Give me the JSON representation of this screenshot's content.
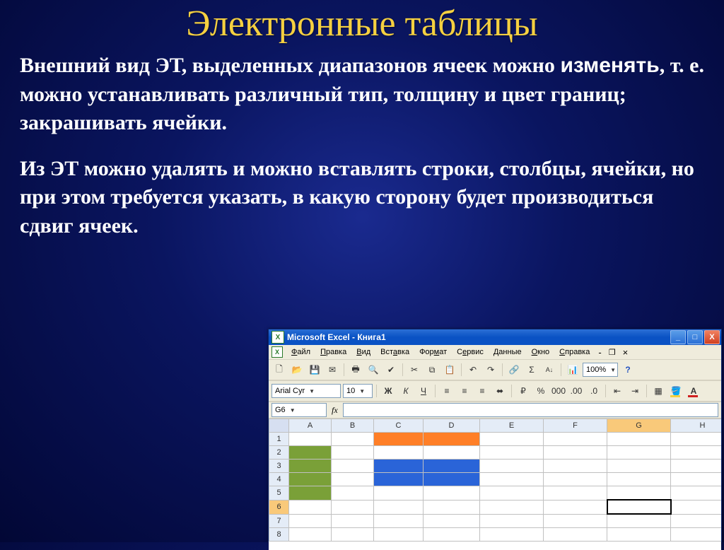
{
  "slide": {
    "title": "Электронные таблицы",
    "para1": "Внешний вид ЭТ, выделенных диапазонов ячеек можно ",
    "para1_emph": "изменять",
    "para1_cont": ", т. е. можно устанавливать различный тип, толщину и цвет границ; закрашивать ячейки.",
    "para2": "Из ЭТ можно удалять и можно вставлять строки, столбцы, ячейки, но при этом требуется указать, в какую сторону будет производиться сдвиг ячеек."
  },
  "excel": {
    "app": "Microsoft Excel",
    "doc": "Книга1",
    "titlebar": "Microsoft Excel - Книга1",
    "menus": [
      "Файл",
      "Правка",
      "Вид",
      "Вставка",
      "Формат",
      "Сервис",
      "Данные",
      "Окно",
      "Справка"
    ],
    "font": "Arial Cyr",
    "font_size": "10",
    "zoom": "100%",
    "active_cell": "G6",
    "columns": [
      "A",
      "B",
      "C",
      "D",
      "E",
      "F",
      "G",
      "H"
    ],
    "rows": [
      "1",
      "2",
      "3",
      "4",
      "5",
      "6",
      "7",
      "8"
    ],
    "colored_cells": {
      "green": [
        "A2",
        "A3",
        "A4",
        "A5"
      ],
      "orange": [
        "C1",
        "D1"
      ],
      "blue": [
        "C3",
        "D3",
        "C4",
        "D4"
      ]
    }
  }
}
